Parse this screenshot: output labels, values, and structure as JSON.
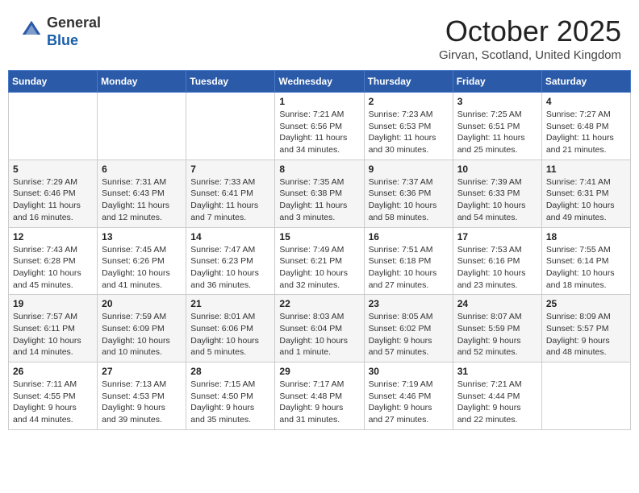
{
  "header": {
    "logo_line1": "General",
    "logo_line2": "Blue",
    "month_title": "October 2025",
    "location": "Girvan, Scotland, United Kingdom"
  },
  "days_of_week": [
    "Sunday",
    "Monday",
    "Tuesday",
    "Wednesday",
    "Thursday",
    "Friday",
    "Saturday"
  ],
  "weeks": [
    [
      {
        "day": "",
        "info": ""
      },
      {
        "day": "",
        "info": ""
      },
      {
        "day": "",
        "info": ""
      },
      {
        "day": "1",
        "info": "Sunrise: 7:21 AM\nSunset: 6:56 PM\nDaylight: 11 hours\nand 34 minutes."
      },
      {
        "day": "2",
        "info": "Sunrise: 7:23 AM\nSunset: 6:53 PM\nDaylight: 11 hours\nand 30 minutes."
      },
      {
        "day": "3",
        "info": "Sunrise: 7:25 AM\nSunset: 6:51 PM\nDaylight: 11 hours\nand 25 minutes."
      },
      {
        "day": "4",
        "info": "Sunrise: 7:27 AM\nSunset: 6:48 PM\nDaylight: 11 hours\nand 21 minutes."
      }
    ],
    [
      {
        "day": "5",
        "info": "Sunrise: 7:29 AM\nSunset: 6:46 PM\nDaylight: 11 hours\nand 16 minutes."
      },
      {
        "day": "6",
        "info": "Sunrise: 7:31 AM\nSunset: 6:43 PM\nDaylight: 11 hours\nand 12 minutes."
      },
      {
        "day": "7",
        "info": "Sunrise: 7:33 AM\nSunset: 6:41 PM\nDaylight: 11 hours\nand 7 minutes."
      },
      {
        "day": "8",
        "info": "Sunrise: 7:35 AM\nSunset: 6:38 PM\nDaylight: 11 hours\nand 3 minutes."
      },
      {
        "day": "9",
        "info": "Sunrise: 7:37 AM\nSunset: 6:36 PM\nDaylight: 10 hours\nand 58 minutes."
      },
      {
        "day": "10",
        "info": "Sunrise: 7:39 AM\nSunset: 6:33 PM\nDaylight: 10 hours\nand 54 minutes."
      },
      {
        "day": "11",
        "info": "Sunrise: 7:41 AM\nSunset: 6:31 PM\nDaylight: 10 hours\nand 49 minutes."
      }
    ],
    [
      {
        "day": "12",
        "info": "Sunrise: 7:43 AM\nSunset: 6:28 PM\nDaylight: 10 hours\nand 45 minutes."
      },
      {
        "day": "13",
        "info": "Sunrise: 7:45 AM\nSunset: 6:26 PM\nDaylight: 10 hours\nand 41 minutes."
      },
      {
        "day": "14",
        "info": "Sunrise: 7:47 AM\nSunset: 6:23 PM\nDaylight: 10 hours\nand 36 minutes."
      },
      {
        "day": "15",
        "info": "Sunrise: 7:49 AM\nSunset: 6:21 PM\nDaylight: 10 hours\nand 32 minutes."
      },
      {
        "day": "16",
        "info": "Sunrise: 7:51 AM\nSunset: 6:18 PM\nDaylight: 10 hours\nand 27 minutes."
      },
      {
        "day": "17",
        "info": "Sunrise: 7:53 AM\nSunset: 6:16 PM\nDaylight: 10 hours\nand 23 minutes."
      },
      {
        "day": "18",
        "info": "Sunrise: 7:55 AM\nSunset: 6:14 PM\nDaylight: 10 hours\nand 18 minutes."
      }
    ],
    [
      {
        "day": "19",
        "info": "Sunrise: 7:57 AM\nSunset: 6:11 PM\nDaylight: 10 hours\nand 14 minutes."
      },
      {
        "day": "20",
        "info": "Sunrise: 7:59 AM\nSunset: 6:09 PM\nDaylight: 10 hours\nand 10 minutes."
      },
      {
        "day": "21",
        "info": "Sunrise: 8:01 AM\nSunset: 6:06 PM\nDaylight: 10 hours\nand 5 minutes."
      },
      {
        "day": "22",
        "info": "Sunrise: 8:03 AM\nSunset: 6:04 PM\nDaylight: 10 hours\nand 1 minute."
      },
      {
        "day": "23",
        "info": "Sunrise: 8:05 AM\nSunset: 6:02 PM\nDaylight: 9 hours\nand 57 minutes."
      },
      {
        "day": "24",
        "info": "Sunrise: 8:07 AM\nSunset: 5:59 PM\nDaylight: 9 hours\nand 52 minutes."
      },
      {
        "day": "25",
        "info": "Sunrise: 8:09 AM\nSunset: 5:57 PM\nDaylight: 9 hours\nand 48 minutes."
      }
    ],
    [
      {
        "day": "26",
        "info": "Sunrise: 7:11 AM\nSunset: 4:55 PM\nDaylight: 9 hours\nand 44 minutes."
      },
      {
        "day": "27",
        "info": "Sunrise: 7:13 AM\nSunset: 4:53 PM\nDaylight: 9 hours\nand 39 minutes."
      },
      {
        "day": "28",
        "info": "Sunrise: 7:15 AM\nSunset: 4:50 PM\nDaylight: 9 hours\nand 35 minutes."
      },
      {
        "day": "29",
        "info": "Sunrise: 7:17 AM\nSunset: 4:48 PM\nDaylight: 9 hours\nand 31 minutes."
      },
      {
        "day": "30",
        "info": "Sunrise: 7:19 AM\nSunset: 4:46 PM\nDaylight: 9 hours\nand 27 minutes."
      },
      {
        "day": "31",
        "info": "Sunrise: 7:21 AM\nSunset: 4:44 PM\nDaylight: 9 hours\nand 22 minutes."
      },
      {
        "day": "",
        "info": ""
      }
    ]
  ]
}
